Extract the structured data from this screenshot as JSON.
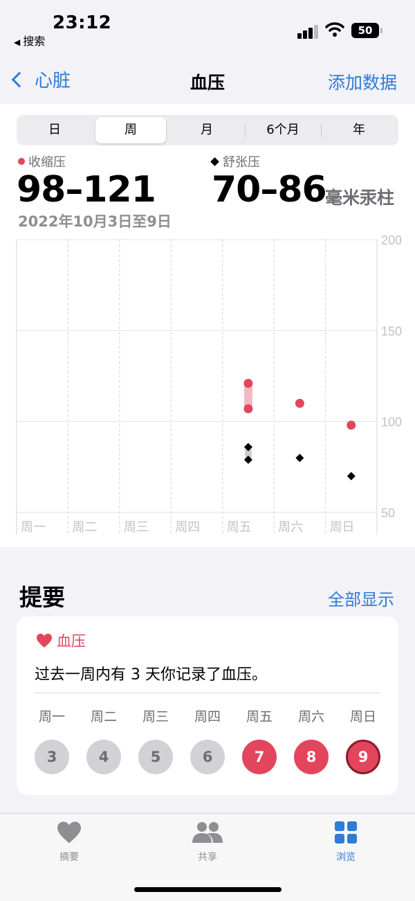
{
  "status_bar": {
    "time": "23:12",
    "back_app": "搜索",
    "battery": "50"
  },
  "nav": {
    "back_label": "心脏",
    "title": "血压",
    "action_label": "添加数据"
  },
  "segments": {
    "items": [
      "日",
      "周",
      "月",
      "6个月",
      "年"
    ],
    "selected": "周"
  },
  "summary_values": {
    "systolic_label": "收缩压",
    "systolic_range": "98–121",
    "diastolic_label": "舒张压",
    "diastolic_range": "70–86",
    "unit": "毫米汞柱",
    "date_range": "2022年10月3日至9日"
  },
  "colors": {
    "accent": "#2f7bd8",
    "systolic": "#e3455d",
    "systolic_range_bar": "#f4b8c2",
    "diastolic": "#000000",
    "diastolic_range_bar": "#cfcfd3"
  },
  "chart_data": {
    "type": "scatter",
    "categories": [
      "周一",
      "周二",
      "周三",
      "周四",
      "周五",
      "周六",
      "周日"
    ],
    "ylim": [
      50,
      200
    ],
    "yticks": [
      200,
      150,
      100,
      50
    ],
    "grid": true,
    "series": [
      {
        "name": "收缩压",
        "marker": "circle",
        "points": [
          {
            "day": "周五",
            "min": 107,
            "max": 121
          },
          {
            "day": "周六",
            "min": 110,
            "max": 110
          },
          {
            "day": "周日",
            "min": 98,
            "max": 98
          }
        ]
      },
      {
        "name": "舒张压",
        "marker": "diamond",
        "points": [
          {
            "day": "周五",
            "min": 79,
            "max": 86
          },
          {
            "day": "周六",
            "min": 80,
            "max": 80
          },
          {
            "day": "周日",
            "min": 70,
            "max": 70
          }
        ]
      }
    ]
  },
  "highlights": {
    "title": "提要",
    "show_all": "全部显示",
    "card_title": "血压",
    "card_text": "过去一周内有 3 天你记录了血压。",
    "days": [
      {
        "label": "周一",
        "num": "3",
        "state": "off"
      },
      {
        "label": "周二",
        "num": "4",
        "state": "off"
      },
      {
        "label": "周三",
        "num": "5",
        "state": "off"
      },
      {
        "label": "周四",
        "num": "6",
        "state": "off"
      },
      {
        "label": "周五",
        "num": "7",
        "state": "on"
      },
      {
        "label": "周六",
        "num": "8",
        "state": "on"
      },
      {
        "label": "周日",
        "num": "9",
        "state": "today"
      }
    ]
  },
  "tabbar": {
    "items": [
      {
        "label": "摘要",
        "icon": "heart-icon"
      },
      {
        "label": "共享",
        "icon": "people-icon"
      },
      {
        "label": "浏览",
        "icon": "grid-icon",
        "selected": true
      }
    ]
  }
}
